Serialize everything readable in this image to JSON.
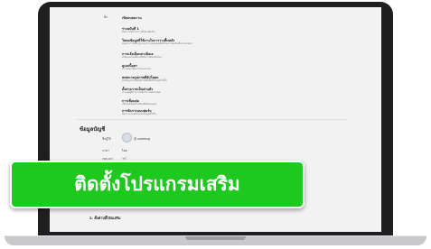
{
  "settings_list": {
    "row_label": "สิ่ง",
    "header_value": "เขียนบทความ",
    "items": [
      {
        "title": "ร่างฉบับที่ 1",
        "desc": "ข้อความอธิบายการตั้งค่าเพิ่มเติม"
      },
      {
        "title": "โหลดข้อมูลที่ใช้งานในการวางพื้นหลัง",
        "desc": "คุณสามารถเลือกรูปแบบการแสดงผลเพื่อให้เหมาะสมกับเนื้อหาของคุณ"
      },
      {
        "title": "การแจ้งเตือนทางอีเมล",
        "desc": "ส่งอีเมลแจ้งเตือนเมื่อมีความคิดเห็นใหม่"
      },
      {
        "title": "ดูแลเนื้อหา",
        "desc": "ตรวจสอบเนื้อหาก่อนเผยแพร่"
      },
      {
        "title": "ลดขนาดรูปภาพที่อัปโหลด",
        "desc": "บีบอัดรูปภาพโดยอัตโนมัติเพื่อให้โหลดเร็วขึ้น"
      },
      {
        "title": "ตั้งค่าความเป็นส่วนตัว",
        "desc": "กำหนดผู้ที่สามารถเห็นโปรไฟล์ของคุณ"
      },
      {
        "title": "การเชื่อมต่อ",
        "desc": "เชื่อมต่อบัญชีโซเชียลมีเดียของคุณ"
      },
      {
        "title": "การจัดการแบบฟอร์ม",
        "desc": "จัดการแบบฟอร์มและข้อมูลที่ได้รับ"
      }
    ]
  },
  "account_section": {
    "heading": "ข้อมูลบัญชี",
    "fields": [
      {
        "label": "ชื่อผู้ใช้",
        "value": "@ usermsg"
      },
      {
        "label": "ภาษา",
        "value": "ไทย"
      },
      {
        "label": "เขตเวลา",
        "value": "+7"
      }
    ]
  },
  "bottom_heading": "2. ตั้งค่าปลั๊กอินเสริม",
  "banner": {
    "text": "ติดตั้งโปรแกรมเสริม",
    "color": "#1ec81e"
  }
}
